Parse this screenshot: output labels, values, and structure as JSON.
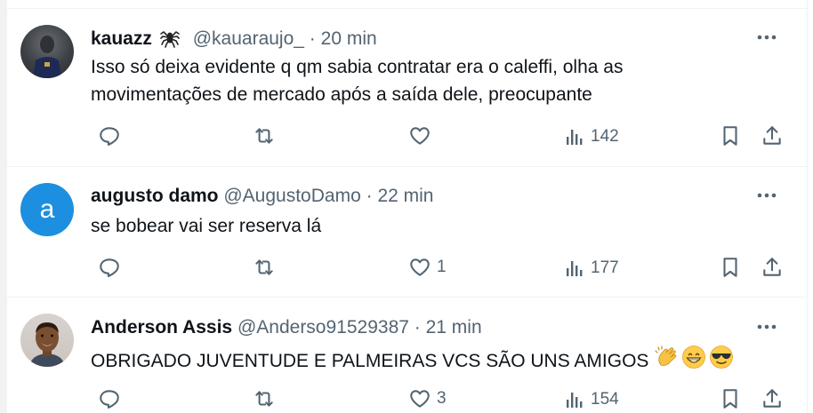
{
  "tweets": [
    {
      "name": "kauazz",
      "handle": "@kauaraujo_",
      "dot": "·",
      "time": "20 min",
      "lines": [
        "Isso só deixa evidente q qm sabia contratar era o caleffi, olha as",
        "movimentações de mercado após a saída dele, preocupante"
      ],
      "likes": "",
      "views": "142"
    },
    {
      "name": "augusto damo",
      "handle": "@AugustoDamo",
      "dot": "·",
      "time": "22 min",
      "avatar_letter": "a",
      "lines": [
        "se bobear vai ser reserva lá"
      ],
      "likes": "1",
      "views": "177"
    },
    {
      "name": "Anderson Assis",
      "handle": "@Anderso91529387",
      "dot": "·",
      "time": "21 min",
      "lines": [
        "OBRIGADO JUVENTUDE E PALMEIRAS VCS SÃO UNS AMIGOS"
      ],
      "likes": "3",
      "views": "154"
    }
  ],
  "icons": {
    "name_badge": "spider-emoji-icon",
    "reply": "reply-icon",
    "retweet": "retweet-icon",
    "like": "heart-icon",
    "views": "views-icon",
    "bookmark": "bookmark-icon",
    "share": "share-icon",
    "more": "more-icon",
    "emojis_tweet3": [
      "clapping-hands-emoji",
      "grinning-face-emoji",
      "sunglasses-face-emoji"
    ]
  },
  "colors": {
    "text": "#0f1419",
    "secondary": "#536471",
    "avatar_letter_bg": "#1d8fe0",
    "separator": "#eff3f4"
  }
}
